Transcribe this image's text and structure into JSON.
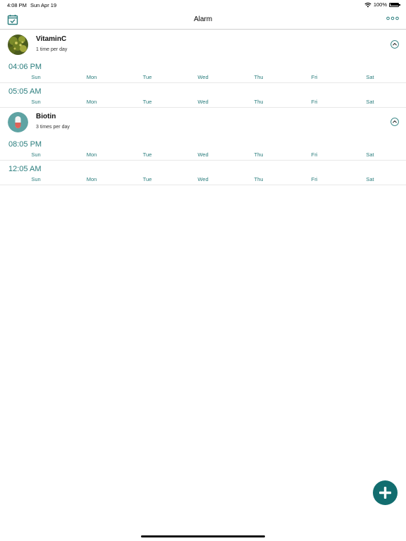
{
  "status_bar": {
    "time": "4:08 PM",
    "date": "Sun Apr 19",
    "battery": "100%",
    "battery_level": 1.0
  },
  "nav": {
    "title": "Alarm",
    "left_icon": "calendar-check-icon",
    "right_icon": "more-horizontal-icon"
  },
  "colors": {
    "accent": "#2a7d7d",
    "fab": "#126d6f"
  },
  "days": [
    "Sun",
    "Mon",
    "Tue",
    "Wed",
    "Thu",
    "Fri",
    "Sat"
  ],
  "medications": [
    {
      "name": "VitaminC",
      "frequency": "1 time per day",
      "avatar": "plant-photo",
      "alarms": [
        "04:06 PM",
        "05:05 AM"
      ]
    },
    {
      "name": "Biotin",
      "frequency": "3 times per day",
      "avatar": "capsule-icon",
      "alarms": [
        "08:05 PM",
        "12:05 AM"
      ]
    }
  ],
  "fab": {
    "icon": "plus-icon"
  }
}
